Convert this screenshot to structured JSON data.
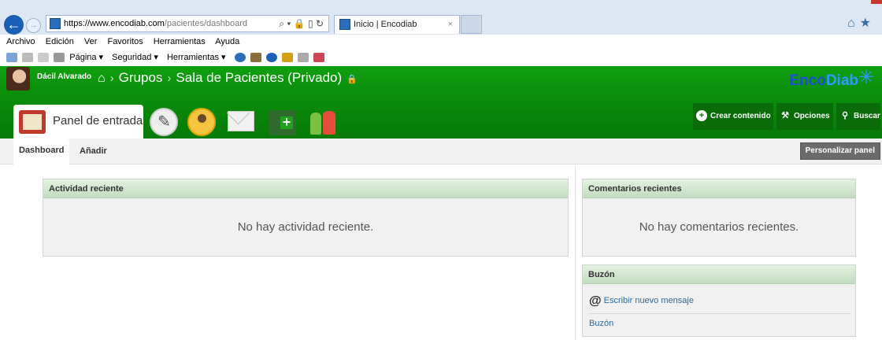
{
  "browser": {
    "url_host": "https://www.encodiab.com",
    "url_path": "/pacientes/dashboard",
    "addr_tools": "⌕ ▾ 🔒 ▯ ↻",
    "tab_title": "Inicio | Encodiab",
    "tab_close": "×",
    "menu": [
      "Archivo",
      "Edición",
      "Ver",
      "Favoritos",
      "Herramientas",
      "Ayuda"
    ],
    "commands": [
      "Página ▾",
      "Seguridad ▾",
      "Herramientas ▾"
    ]
  },
  "header": {
    "user_name": "Dácil Alvarado",
    "crumbs": [
      "Grupos",
      "Sala de Pacientes (Privado)"
    ],
    "logo_part1": "Enco",
    "logo_part2": "Diab"
  },
  "nav": {
    "panel_label": "Panel de entrada",
    "actions": {
      "create": "Crear contenido",
      "options": "Opciones",
      "search": "Buscar"
    }
  },
  "subtabs": {
    "dashboard": "Dashboard",
    "add": "Añadir",
    "customize": "Personalizar panel"
  },
  "panels": {
    "activity": {
      "title": "Actividad reciente",
      "empty": "No hay actividad reciente."
    },
    "comments": {
      "title": "Comentarios recientes",
      "empty": "No hay comentarios recientes."
    },
    "inbox": {
      "title": "Buzón",
      "write": "Escribir nuevo mensaje",
      "inbox_link": "Buzón"
    }
  },
  "colors": {
    "site_green": "#0b8f0b",
    "panel_header": "#c2ddbf",
    "link_blue": "#2c6aa0"
  }
}
